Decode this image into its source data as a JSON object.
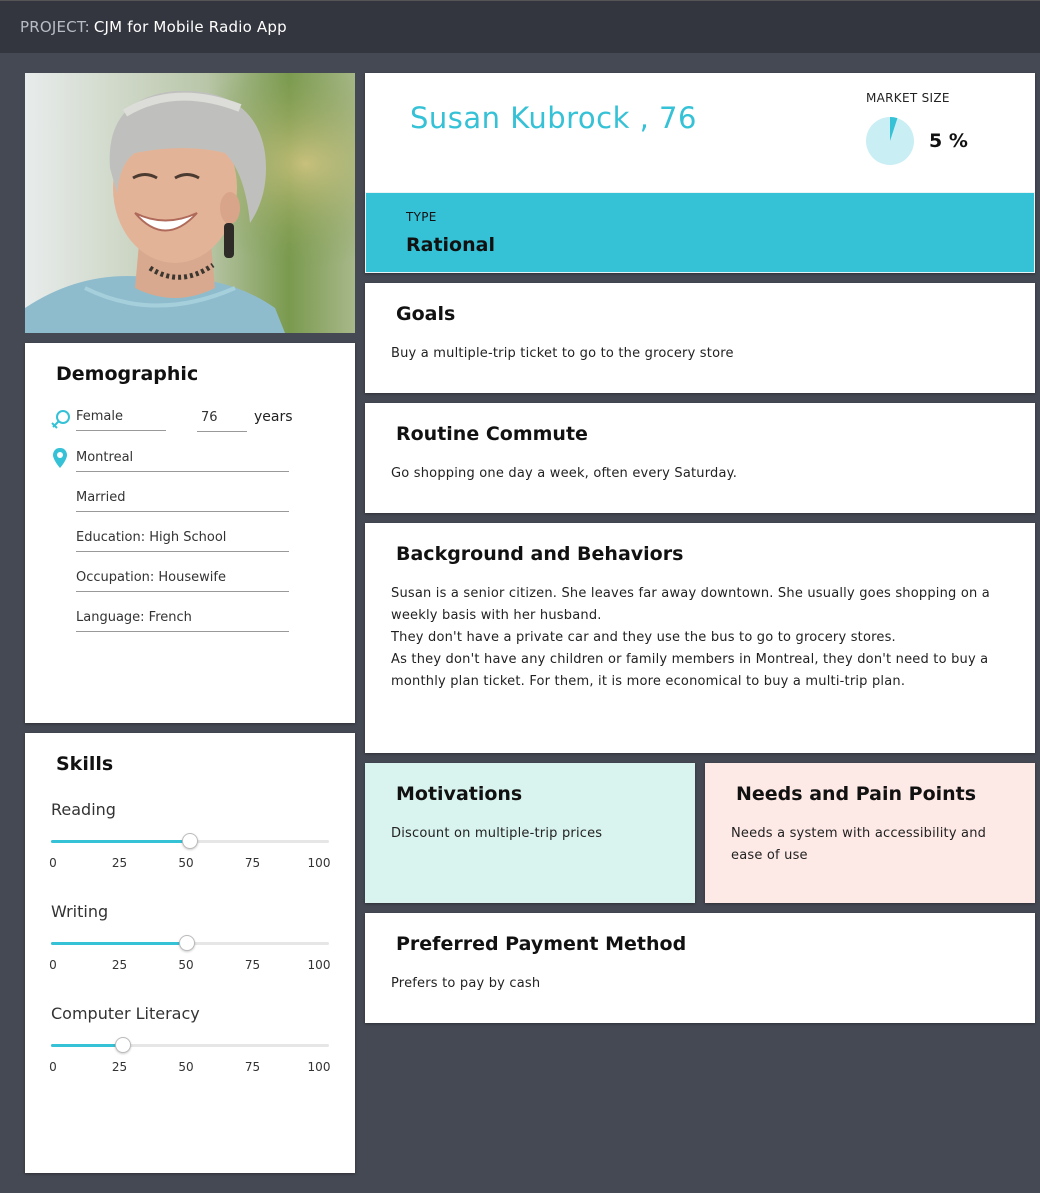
{
  "project": {
    "label": "PROJECT:",
    "name": "CJM for Mobile Radio App"
  },
  "demographic": {
    "title": "Demographic",
    "gender": "Female",
    "age": "76",
    "age_unit": "years",
    "city": "Montreal",
    "marital_status": "Married",
    "education": "Education: High School",
    "occupation": "Occupation: Housewife",
    "language": "Language: French"
  },
  "skills": {
    "title": "Skills",
    "tick_labels": [
      "0",
      "25",
      "50",
      "75",
      "100"
    ],
    "items": [
      {
        "label": "Reading",
        "value": 50
      },
      {
        "label": "Writing",
        "value": 49
      },
      {
        "label": "Computer Literacy",
        "value": 26
      }
    ]
  },
  "persona": {
    "name": "Susan Kubrock , 76",
    "market_size_label": "MARKET SIZE",
    "market_size_value": "5 %",
    "market_size_fraction": 0.05,
    "type_label": "TYPE",
    "type_value": "Rational"
  },
  "goals": {
    "title": "Goals",
    "text": "Buy a multiple-trip ticket to go to the grocery store"
  },
  "routine": {
    "title": "Routine Commute",
    "text": "Go shopping one day a week, often every Saturday."
  },
  "background": {
    "title": "Background and Behaviors",
    "paragraphs": [
      "Susan is a senior citizen. She leaves far away downtown. She usually goes shopping on a weekly basis with her husband.",
      "They don't have a private car and they use the bus to go to grocery stores.",
      "As they don't have any children or family members in Montreal, they don't need to buy a monthly plan ticket. For them, it is more economical to buy a multi-trip plan."
    ]
  },
  "motivations": {
    "title": "Motivations",
    "text": "Discount on multiple-trip prices"
  },
  "needs": {
    "title": "Needs and Pain Points",
    "text": "Needs a system with accessibility and ease of use"
  },
  "payment": {
    "title": "Preferred Payment Method",
    "text": "Prefers to pay by cash"
  },
  "colors": {
    "accent": "#35c1d6",
    "background": "#454953",
    "topbar": "#33363e",
    "motivations_bg": "#d9f3ee",
    "needs_bg": "#fde9e6"
  }
}
